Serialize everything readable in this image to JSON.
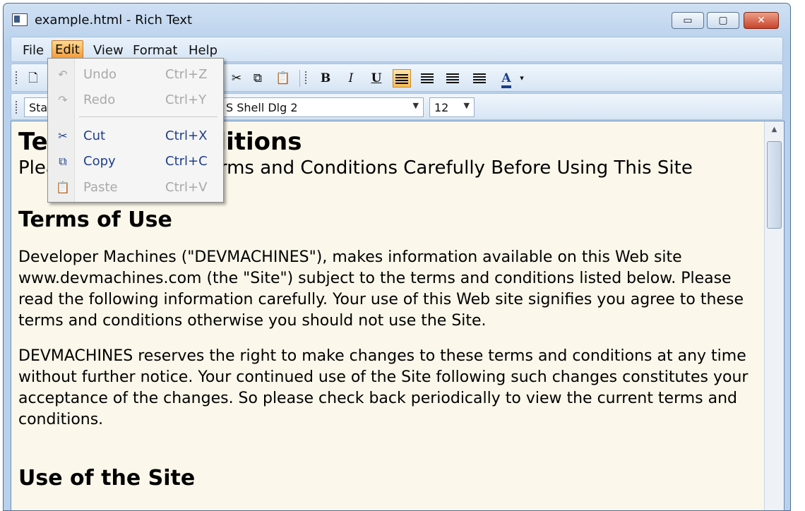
{
  "window": {
    "title": "example.html - Rich Text"
  },
  "window_controls": {
    "minimize": "▭",
    "maximize": "▢",
    "close": "✕"
  },
  "menubar": {
    "items": [
      "File",
      "Edit",
      "View",
      "Format",
      "Help"
    ],
    "active": "Edit"
  },
  "toolbar": {
    "bold": "B",
    "italic": "I",
    "underline": "U",
    "font_color": "A",
    "color_dropdown": "▾"
  },
  "format_bar": {
    "style_value": "Star",
    "font_value": "S Shell Dlg 2",
    "size_value": "12"
  },
  "edit_menu": {
    "items": [
      {
        "label": "Undo",
        "shortcut": "Ctrl+Z",
        "icon": "undo-icon",
        "enabled": false
      },
      {
        "label": "Redo",
        "shortcut": "Ctrl+Y",
        "icon": "redo-icon",
        "enabled": false
      },
      {
        "label": "Cut",
        "shortcut": "Ctrl+X",
        "icon": "scissors-icon",
        "enabled": true
      },
      {
        "label": "Copy",
        "shortcut": "Ctrl+C",
        "icon": "copy-icon",
        "enabled": true
      },
      {
        "label": "Paste",
        "shortcut": "Ctrl+V",
        "icon": "paste-icon",
        "enabled": false
      }
    ]
  },
  "document": {
    "title_visible": "Te",
    "title_visible_end": "ditions",
    "subtitle_visible": "Plea",
    "subtitle_visible_end": "rms and Conditions Carefully Before Using This Site",
    "heading1": "Terms of Use",
    "paragraph1": "Developer Machines (\"DEVMACHINES\"), makes information available on this Web site www.devmachines.com (the \"Site\") subject to the terms and conditions listed below. Please read the following information carefully. Your use of this Web site signifies you agree to these terms and conditions otherwise you should not use the Site.",
    "paragraph2": "DEVMACHINES reserves the right to make changes to these terms and conditions at any time without further notice. Your continued use of the Site following such changes constitutes your acceptance of the changes. So please check back periodically to view the current terms and conditions.",
    "heading2": "Use of the Site"
  },
  "colors": {
    "accent_menu": "#f19a3c",
    "enabled_menu_text": "#1f3f8a",
    "disabled_menu_text": "#a9a9a9",
    "editor_bg": "#fbf7ea"
  }
}
